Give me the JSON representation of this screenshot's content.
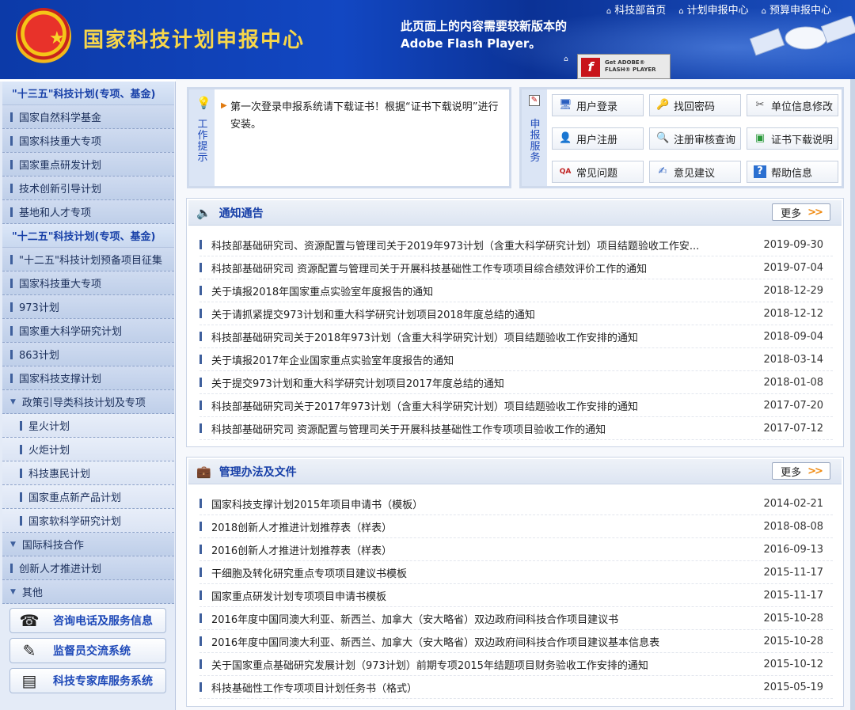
{
  "header": {
    "site_title": "国家科技计划申报中心",
    "flash_message": "此页面上的内容需要较新版本的 Adobe Flash Player。",
    "flash_badge_line1": "Get ADOBE®",
    "flash_badge_line2": "FLASH® PLAYER",
    "top_nav": [
      "科技部首页",
      "计划申报中心",
      "预算申报中心"
    ]
  },
  "sidebar": {
    "groups": [
      {
        "label": "\"十三五\"科技计划(专项、基金)",
        "type": "header"
      },
      {
        "label": "国家自然科学基金",
        "type": "item"
      },
      {
        "label": "国家科技重大专项",
        "type": "item"
      },
      {
        "label": "国家重点研发计划",
        "type": "item"
      },
      {
        "label": "技术创新引导计划",
        "type": "item"
      },
      {
        "label": "基地和人才专项",
        "type": "item"
      },
      {
        "label": "\"十二五\"科技计划(专项、基金)",
        "type": "header"
      },
      {
        "label": "\"十二五\"科技计划预备项目征集",
        "type": "item"
      },
      {
        "label": "国家科技重大专项",
        "type": "item"
      },
      {
        "label": "973计划",
        "type": "item"
      },
      {
        "label": "国家重大科学研究计划",
        "type": "item"
      },
      {
        "label": "863计划",
        "type": "item"
      },
      {
        "label": "国家科技支撑计划",
        "type": "item"
      },
      {
        "label": "政策引导类科技计划及专项",
        "type": "expand"
      },
      {
        "label": "星火计划",
        "type": "sub"
      },
      {
        "label": "火炬计划",
        "type": "sub"
      },
      {
        "label": "科技惠民计划",
        "type": "sub"
      },
      {
        "label": "国家重点新产品计划",
        "type": "sub"
      },
      {
        "label": "国家软科学研究计划",
        "type": "sub"
      },
      {
        "label": "国际科技合作",
        "type": "expand"
      },
      {
        "label": "创新人才推进计划",
        "type": "item"
      },
      {
        "label": "其他",
        "type": "expand"
      }
    ],
    "buttons": [
      "咨询电话及服务信息",
      "监督员交流系统",
      "科技专家库服务系统"
    ]
  },
  "tip": {
    "vertical_label": "工作提示",
    "text": "第一次登录申报系统请下载证书！根据“证书下载说明”进行安装。"
  },
  "service": {
    "vertical_label": "申报服务",
    "buttons": [
      "用户登录",
      "找回密码",
      "单位信息修改",
      "用户注册",
      "注册审核查询",
      "证书下载说明",
      "常见问题",
      "意见建议",
      "帮助信息"
    ]
  },
  "notices": {
    "title": "通知通告",
    "more": "更多",
    "rows": [
      {
        "title": "科技部基础研究司、资源配置与管理司关于2019年973计划（含重大科学研究计划）项目结题验收工作安...",
        "date": "2019-09-30"
      },
      {
        "title": "科技部基础研究司 资源配置与管理司关于开展科技基础性工作专项项目综合绩效评价工作的通知",
        "date": "2019-07-04"
      },
      {
        "title": "关于填报2018年国家重点实验室年度报告的通知",
        "date": "2018-12-29"
      },
      {
        "title": "关于请抓紧提交973计划和重大科学研究计划项目2018年度总结的通知",
        "date": "2018-12-12"
      },
      {
        "title": "科技部基础研究司关于2018年973计划（含重大科学研究计划）项目结题验收工作安排的通知",
        "date": "2018-09-04"
      },
      {
        "title": "关于填报2017年企业国家重点实验室年度报告的通知",
        "date": "2018-03-14"
      },
      {
        "title": "关于提交973计划和重大科学研究计划项目2017年度总结的通知",
        "date": "2018-01-08"
      },
      {
        "title": "科技部基础研究司关于2017年973计划（含重大科学研究计划）项目结题验收工作安排的通知",
        "date": "2017-07-20"
      },
      {
        "title": "科技部基础研究司 资源配置与管理司关于开展科技基础性工作专项项目验收工作的通知",
        "date": "2017-07-12"
      }
    ]
  },
  "documents": {
    "title": "管理办法及文件",
    "more": "更多",
    "rows": [
      {
        "title": "国家科技支撑计划2015年项目申请书（模板）",
        "date": "2014-02-21"
      },
      {
        "title": "2018创新人才推进计划推荐表（样表）",
        "date": "2018-08-08"
      },
      {
        "title": "2016创新人才推进计划推荐表（样表）",
        "date": "2016-09-13"
      },
      {
        "title": "干细胞及转化研究重点专项项目建议书模板",
        "date": "2015-11-17"
      },
      {
        "title": "国家重点研发计划专项项目申请书模板",
        "date": "2015-11-17"
      },
      {
        "title": "2016年度中国同澳大利亚、新西兰、加拿大（安大略省）双边政府间科技合作项目建议书",
        "date": "2015-10-28"
      },
      {
        "title": "2016年度中国同澳大利亚、新西兰、加拿大（安大略省）双边政府间科技合作项目建议基本信息表",
        "date": "2015-10-28"
      },
      {
        "title": "关于国家重点基础研究发展计划（973计划）前期专项2015年结题项目财务验收工作安排的通知",
        "date": "2015-10-12"
      },
      {
        "title": "科技基础性工作专项项目计划任务书（格式）",
        "date": "2015-05-19"
      }
    ]
  }
}
